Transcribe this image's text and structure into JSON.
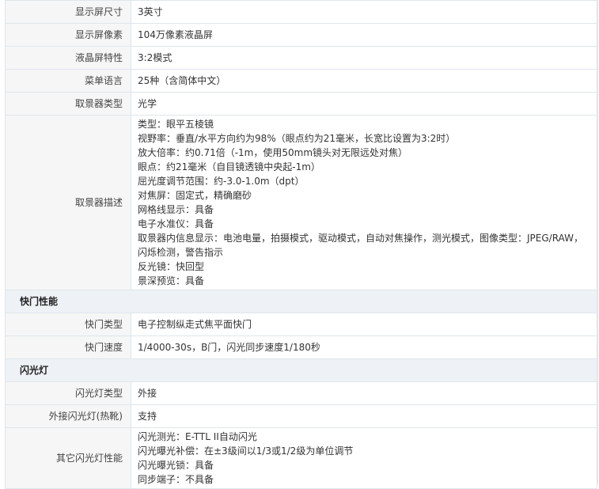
{
  "rows": [
    {
      "label": "显示屏尺寸",
      "value": "3英寸"
    },
    {
      "label": "显示屏像素",
      "value": "104万像素液晶屏"
    },
    {
      "label": "液晶屏特性",
      "value": "3:2模式"
    },
    {
      "label": "菜单语言",
      "value": "25种（含简体中文）"
    },
    {
      "label": "取景器类型",
      "value": "光学"
    }
  ],
  "viewfinder": {
    "label": "取景器描述",
    "lines": [
      "类型：眼平五棱镜",
      "视野率：垂直/水平方向约为98%（眼点约为21毫米，长宽比设置为3:2时）",
      "放大倍率：约0.71倍（-1m，使用50mm镜头对无限远处对焦）",
      "眼点：约21毫米（自目镜透镜中央起-1m）",
      "屈光度调节范围：约-3.0-1.0m（dpt）",
      "对焦屏：固定式，精确磨砂",
      "网格线显示：具备",
      "电子水准仪：具备",
      "取景器内信息显示：电池电量，拍摄模式，驱动模式，自动对焦操作，测光模式，图像类型：JPEG/RAW，闪烁检测，警告指示",
      "反光镜：快回型",
      "景深预览：具备"
    ]
  },
  "shutter": {
    "heading": "快门性能",
    "rows": [
      {
        "label": "快门类型",
        "value": "电子控制纵走式焦平面快门"
      },
      {
        "label": "快门速度",
        "value": "1/4000-30s，B门，闪光同步速度1/180秒"
      }
    ]
  },
  "flash": {
    "heading": "闪光灯",
    "rows": [
      {
        "label": "闪光灯类型",
        "value": "外接"
      },
      {
        "label": "外接闪光灯(热靴)",
        "value": "支持"
      }
    ],
    "other": {
      "label": "其它闪光灯性能",
      "lines": [
        "闪光测光：E-TTL II自动闪光",
        "闪光曝光补偿：在±3级间以1/3或1/2级为单位调节",
        "闪光曝光锁：具备",
        "同步端子：不具备"
      ]
    }
  }
}
